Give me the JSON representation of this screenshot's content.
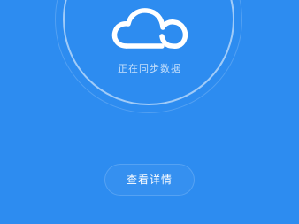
{
  "sync": {
    "status_text": "正在同步数据",
    "icon": "cloud-icon"
  },
  "actions": {
    "view_details_label": "查看详情"
  },
  "colors": {
    "background": "#2d8cf0",
    "ring": "#ffffff",
    "icon": "#ffffff"
  }
}
